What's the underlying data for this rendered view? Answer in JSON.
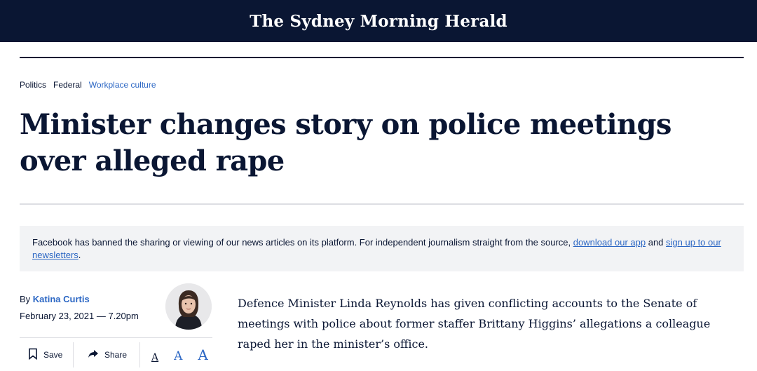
{
  "masthead": {
    "title": "The Sydney Morning Herald"
  },
  "breadcrumb": [
    "Politics",
    "Federal",
    "Workplace culture"
  ],
  "headline": "Minister changes story on police meetings over alleged rape",
  "notice": {
    "text_before": "Facebook has banned the sharing or viewing of our news articles on its platform. For independent journalism straight from the source, ",
    "link1": "download our app",
    "text_middle": " and ",
    "link2": "sign up to our newsletters",
    "text_after": "."
  },
  "byline": {
    "prefix": "By ",
    "author": "Katina Curtis",
    "date": "February 23, 2021 — 7.20pm"
  },
  "tools": {
    "save": "Save",
    "share": "Share",
    "font_small": "A",
    "font_medium": "A",
    "font_large": "A"
  },
  "article": {
    "first_paragraph": "Defence Minister Linda Reynolds has given conflicting accounts to the Senate of meetings with police about former staffer Brittany Higgins’ allegations a colleague raped her in the minister’s office."
  },
  "colors": {
    "navy": "#0a1633",
    "link": "#2c67c4",
    "notice_bg": "#f2f3f5"
  }
}
